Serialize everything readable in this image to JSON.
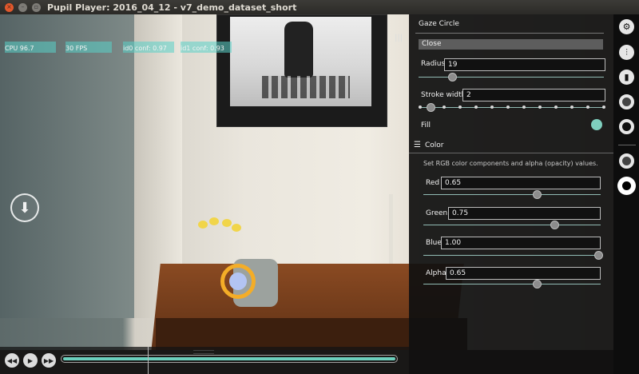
{
  "window": {
    "title": "Pupil Player: 2016_04_12 - v7_demo_dataset_short"
  },
  "stats": {
    "cpu": "CPU 96.7",
    "fps": "30 FPS",
    "id0": "id0 conf: 0.97",
    "id1": "id1 conf: 0.93"
  },
  "panel": {
    "title": "Gaze Circle",
    "close_label": "Close",
    "radius_label": "Radius",
    "radius_value": "19",
    "stroke_label": "Stroke width",
    "stroke_value": "2",
    "fill_label": "Fill",
    "color_header": "Color",
    "color_help": "Set RGB color components and alpha (opacity) values.",
    "red_label": "Red",
    "red_value": "0.65",
    "green_label": "Green",
    "green_value": "0.75",
    "blue_label": "Blue",
    "blue_value": "1.00",
    "alpha_label": "Alpha",
    "alpha_value": "0.65"
  },
  "icons": {
    "grip": "|||",
    "download": "⬇",
    "settings": "⚙",
    "adjust": "⫶",
    "chart": "▮"
  },
  "colors": {
    "accent": "#6ccfbd",
    "gaze_ring": "#f4ad27",
    "gaze_fill": "#b3c4f3"
  }
}
